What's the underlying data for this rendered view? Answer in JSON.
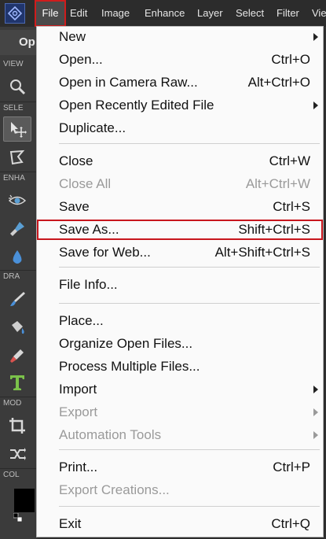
{
  "menubar": {
    "logo_icon": "photoshop-elements-logo",
    "items": [
      "File",
      "Edit",
      "Image",
      "Enhance",
      "Layer",
      "Select",
      "Filter",
      "Vie"
    ]
  },
  "left_panel": {
    "tab": "Op",
    "sections": [
      "VIEW",
      "SELE",
      "ENHA",
      "DRA",
      "MOD",
      "COL"
    ],
    "tools": [
      "zoom-icon",
      "move-icon",
      "lasso-icon",
      "red-eye-icon",
      "brush-healing-icon",
      "blur-drop-icon",
      "brush-icon",
      "paint-bucket-icon",
      "eyedropper-icon",
      "type-icon",
      "crop-icon",
      "recompose-icon"
    ],
    "foreground_color": "#000000"
  },
  "file_menu": {
    "groups": [
      [
        {
          "label": "New",
          "shortcut": "",
          "submenu": true,
          "disabled": false
        },
        {
          "label": "Open...",
          "shortcut": "Ctrl+O",
          "submenu": false,
          "disabled": false
        },
        {
          "label": "Open in Camera Raw...",
          "shortcut": "Alt+Ctrl+O",
          "submenu": false,
          "disabled": false
        },
        {
          "label": "Open Recently Edited File",
          "shortcut": "",
          "submenu": true,
          "disabled": false
        },
        {
          "label": "Duplicate...",
          "shortcut": "",
          "submenu": false,
          "disabled": false
        }
      ],
      [
        {
          "label": "Close",
          "shortcut": "Ctrl+W",
          "submenu": false,
          "disabled": false
        },
        {
          "label": "Close All",
          "shortcut": "Alt+Ctrl+W",
          "submenu": false,
          "disabled": true
        },
        {
          "label": "Save",
          "shortcut": "Ctrl+S",
          "submenu": false,
          "disabled": false
        },
        {
          "label": "Save As...",
          "shortcut": "Shift+Ctrl+S",
          "submenu": false,
          "disabled": false,
          "highlighted": true
        },
        {
          "label": "Save for Web...",
          "shortcut": "Alt+Shift+Ctrl+S",
          "submenu": false,
          "disabled": false
        }
      ],
      [
        {
          "label": "File Info...",
          "shortcut": "",
          "submenu": false,
          "disabled": false
        }
      ],
      [
        {
          "label": "Place...",
          "shortcut": "",
          "submenu": false,
          "disabled": false
        },
        {
          "label": "Organize Open Files...",
          "shortcut": "",
          "submenu": false,
          "disabled": false
        },
        {
          "label": "Process Multiple Files...",
          "shortcut": "",
          "submenu": false,
          "disabled": false
        },
        {
          "label": "Import",
          "shortcut": "",
          "submenu": true,
          "disabled": false
        },
        {
          "label": "Export",
          "shortcut": "",
          "submenu": true,
          "disabled": true
        },
        {
          "label": "Automation Tools",
          "shortcut": "",
          "submenu": true,
          "disabled": true
        }
      ],
      [
        {
          "label": "Print...",
          "shortcut": "Ctrl+P",
          "submenu": false,
          "disabled": false
        },
        {
          "label": "Export Creations...",
          "shortcut": "",
          "submenu": false,
          "disabled": true
        }
      ],
      [
        {
          "label": "Exit",
          "shortcut": "Ctrl+Q",
          "submenu": false,
          "disabled": false
        }
      ]
    ]
  },
  "colors": {
    "highlight_border": "#c8161d",
    "menubar_bg": "#2c2c2c",
    "menu_bg": "#fafafa"
  }
}
